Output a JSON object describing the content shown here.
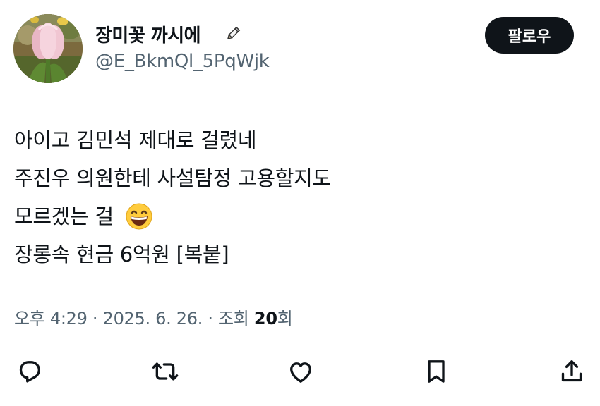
{
  "user": {
    "display_name": "장미꽃 까시에",
    "handle": "@E_BkmQl_5PqWjk",
    "name_badge": "pencil-icon"
  },
  "follow_button": {
    "label": "팔로우"
  },
  "tweet": {
    "lines": [
      "아이고 김민석 제대로 걸렸네",
      "주진우 의원한테 사설탐정 고용할지도",
      "모르겠는 걸",
      "장롱속 현금 6억원 [복붙]"
    ],
    "emoji": "grinning-face-with-smiling-eyes"
  },
  "meta": {
    "time": "오후 4:29",
    "sep1": " · ",
    "date": "2025. 6. 26.",
    "sep2": " · ",
    "views_prefix": "조회 ",
    "views_count": "20",
    "views_suffix": "회"
  },
  "actions": [
    "reply-icon",
    "retweet-icon",
    "like-icon",
    "bookmark-icon",
    "share-icon"
  ],
  "colors": {
    "text": "#0f1419",
    "secondary": "#536471",
    "button_bg": "#0f1419",
    "button_text": "#ffffff"
  }
}
